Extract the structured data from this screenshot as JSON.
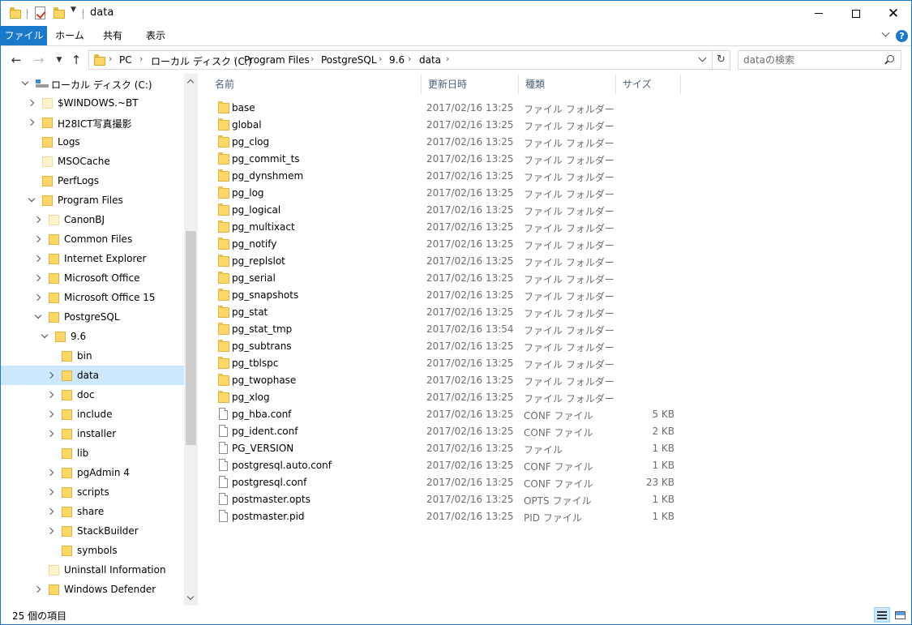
{
  "window": {
    "title": "data"
  },
  "ribbon": {
    "tabs": [
      "ファイル",
      "ホーム",
      "共有",
      "表示"
    ]
  },
  "address": {
    "crumbs": [
      "PC",
      "ローカル ディスク (C:)",
      "Program Files",
      "PostgreSQL",
      "9.6",
      "data"
    ],
    "search_placeholder": "dataの検索"
  },
  "nav": {
    "items": [
      {
        "label": "ローカル ディスク (C:)",
        "icon": "drive-icon",
        "chevron": "down",
        "level": 0,
        "pale": false,
        "selected": false
      },
      {
        "label": "$WINDOWS.~BT",
        "icon": "folder-icon",
        "chevron": "right",
        "level": 1,
        "pale": true,
        "selected": false
      },
      {
        "label": "H28ICT写真撮影",
        "icon": "folder-icon",
        "chevron": "right",
        "level": 1,
        "pale": false,
        "selected": false
      },
      {
        "label": "Logs",
        "icon": "folder-icon",
        "chevron": "",
        "level": 1,
        "pale": false,
        "selected": false
      },
      {
        "label": "MSOCache",
        "icon": "folder-icon",
        "chevron": "",
        "level": 1,
        "pale": true,
        "selected": false
      },
      {
        "label": "PerfLogs",
        "icon": "folder-icon",
        "chevron": "",
        "level": 1,
        "pale": false,
        "selected": false
      },
      {
        "label": "Program Files",
        "icon": "folder-icon",
        "chevron": "down",
        "level": 1,
        "pale": false,
        "selected": false
      },
      {
        "label": "CanonBJ",
        "icon": "folder-icon",
        "chevron": "right",
        "level": 2,
        "pale": true,
        "selected": false
      },
      {
        "label": "Common Files",
        "icon": "folder-icon",
        "chevron": "right",
        "level": 2,
        "pale": false,
        "selected": false
      },
      {
        "label": "Internet Explorer",
        "icon": "folder-icon",
        "chevron": "right",
        "level": 2,
        "pale": false,
        "selected": false
      },
      {
        "label": "Microsoft Office",
        "icon": "folder-icon",
        "chevron": "right",
        "level": 2,
        "pale": false,
        "selected": false
      },
      {
        "label": "Microsoft Office 15",
        "icon": "folder-icon",
        "chevron": "right",
        "level": 2,
        "pale": false,
        "selected": false
      },
      {
        "label": "PostgreSQL",
        "icon": "folder-icon",
        "chevron": "down",
        "level": 2,
        "pale": false,
        "selected": false
      },
      {
        "label": "9.6",
        "icon": "folder-icon",
        "chevron": "down",
        "level": 3,
        "pale": false,
        "selected": false
      },
      {
        "label": "bin",
        "icon": "folder-icon",
        "chevron": "",
        "level": 4,
        "pale": false,
        "selected": false
      },
      {
        "label": "data",
        "icon": "folder-icon",
        "chevron": "right",
        "level": 4,
        "pale": false,
        "selected": true
      },
      {
        "label": "doc",
        "icon": "folder-icon",
        "chevron": "right",
        "level": 4,
        "pale": false,
        "selected": false
      },
      {
        "label": "include",
        "icon": "folder-icon",
        "chevron": "right",
        "level": 4,
        "pale": false,
        "selected": false
      },
      {
        "label": "installer",
        "icon": "folder-icon",
        "chevron": "right",
        "level": 4,
        "pale": false,
        "selected": false
      },
      {
        "label": "lib",
        "icon": "folder-icon",
        "chevron": "",
        "level": 4,
        "pale": false,
        "selected": false
      },
      {
        "label": "pgAdmin 4",
        "icon": "folder-icon",
        "chevron": "right",
        "level": 4,
        "pale": false,
        "selected": false
      },
      {
        "label": "scripts",
        "icon": "folder-icon",
        "chevron": "right",
        "level": 4,
        "pale": false,
        "selected": false
      },
      {
        "label": "share",
        "icon": "folder-icon",
        "chevron": "right",
        "level": 4,
        "pale": false,
        "selected": false
      },
      {
        "label": "StackBuilder",
        "icon": "folder-icon",
        "chevron": "right",
        "level": 4,
        "pale": false,
        "selected": false
      },
      {
        "label": "symbols",
        "icon": "folder-icon",
        "chevron": "",
        "level": 4,
        "pale": false,
        "selected": false
      },
      {
        "label": "Uninstall Information",
        "icon": "folder-icon",
        "chevron": "",
        "level": 2,
        "pale": true,
        "selected": false
      },
      {
        "label": "Windows Defender",
        "icon": "folder-icon",
        "chevron": "right",
        "level": 2,
        "pale": false,
        "selected": false
      }
    ]
  },
  "list": {
    "columns": [
      "名前",
      "更新日時",
      "種類",
      "サイズ"
    ],
    "rows": [
      {
        "name": "base",
        "date": "2017/02/16 13:25",
        "type": "ファイル フォルダー",
        "size": "",
        "kind": "folder"
      },
      {
        "name": "global",
        "date": "2017/02/16 13:25",
        "type": "ファイル フォルダー",
        "size": "",
        "kind": "folder"
      },
      {
        "name": "pg_clog",
        "date": "2017/02/16 13:25",
        "type": "ファイル フォルダー",
        "size": "",
        "kind": "folder"
      },
      {
        "name": "pg_commit_ts",
        "date": "2017/02/16 13:25",
        "type": "ファイル フォルダー",
        "size": "",
        "kind": "folder"
      },
      {
        "name": "pg_dynshmem",
        "date": "2017/02/16 13:25",
        "type": "ファイル フォルダー",
        "size": "",
        "kind": "folder"
      },
      {
        "name": "pg_log",
        "date": "2017/02/16 13:25",
        "type": "ファイル フォルダー",
        "size": "",
        "kind": "folder"
      },
      {
        "name": "pg_logical",
        "date": "2017/02/16 13:25",
        "type": "ファイル フォルダー",
        "size": "",
        "kind": "folder"
      },
      {
        "name": "pg_multixact",
        "date": "2017/02/16 13:25",
        "type": "ファイル フォルダー",
        "size": "",
        "kind": "folder"
      },
      {
        "name": "pg_notify",
        "date": "2017/02/16 13:25",
        "type": "ファイル フォルダー",
        "size": "",
        "kind": "folder"
      },
      {
        "name": "pg_replslot",
        "date": "2017/02/16 13:25",
        "type": "ファイル フォルダー",
        "size": "",
        "kind": "folder"
      },
      {
        "name": "pg_serial",
        "date": "2017/02/16 13:25",
        "type": "ファイル フォルダー",
        "size": "",
        "kind": "folder"
      },
      {
        "name": "pg_snapshots",
        "date": "2017/02/16 13:25",
        "type": "ファイル フォルダー",
        "size": "",
        "kind": "folder"
      },
      {
        "name": "pg_stat",
        "date": "2017/02/16 13:25",
        "type": "ファイル フォルダー",
        "size": "",
        "kind": "folder"
      },
      {
        "name": "pg_stat_tmp",
        "date": "2017/02/16 13:54",
        "type": "ファイル フォルダー",
        "size": "",
        "kind": "folder"
      },
      {
        "name": "pg_subtrans",
        "date": "2017/02/16 13:25",
        "type": "ファイル フォルダー",
        "size": "",
        "kind": "folder"
      },
      {
        "name": "pg_tblspc",
        "date": "2017/02/16 13:25",
        "type": "ファイル フォルダー",
        "size": "",
        "kind": "folder"
      },
      {
        "name": "pg_twophase",
        "date": "2017/02/16 13:25",
        "type": "ファイル フォルダー",
        "size": "",
        "kind": "folder"
      },
      {
        "name": "pg_xlog",
        "date": "2017/02/16 13:25",
        "type": "ファイル フォルダー",
        "size": "",
        "kind": "folder"
      },
      {
        "name": "pg_hba.conf",
        "date": "2017/02/16 13:25",
        "type": "CONF ファイル",
        "size": "5 KB",
        "kind": "file"
      },
      {
        "name": "pg_ident.conf",
        "date": "2017/02/16 13:25",
        "type": "CONF ファイル",
        "size": "2 KB",
        "kind": "file"
      },
      {
        "name": "PG_VERSION",
        "date": "2017/02/16 13:25",
        "type": "ファイル",
        "size": "1 KB",
        "kind": "file"
      },
      {
        "name": "postgresql.auto.conf",
        "date": "2017/02/16 13:25",
        "type": "CONF ファイル",
        "size": "1 KB",
        "kind": "file"
      },
      {
        "name": "postgresql.conf",
        "date": "2017/02/16 13:25",
        "type": "CONF ファイル",
        "size": "23 KB",
        "kind": "file"
      },
      {
        "name": "postmaster.opts",
        "date": "2017/02/16 13:25",
        "type": "OPTS ファイル",
        "size": "1 KB",
        "kind": "file"
      },
      {
        "name": "postmaster.pid",
        "date": "2017/02/16 13:25",
        "type": "PID ファイル",
        "size": "1 KB",
        "kind": "file"
      }
    ]
  },
  "status": {
    "item_count": "25 個の項目"
  },
  "colors": {
    "accent": "#1979ca",
    "selection": "#cce8ff",
    "folder": "#ffd766",
    "muted_text": "#6d6d6d"
  }
}
